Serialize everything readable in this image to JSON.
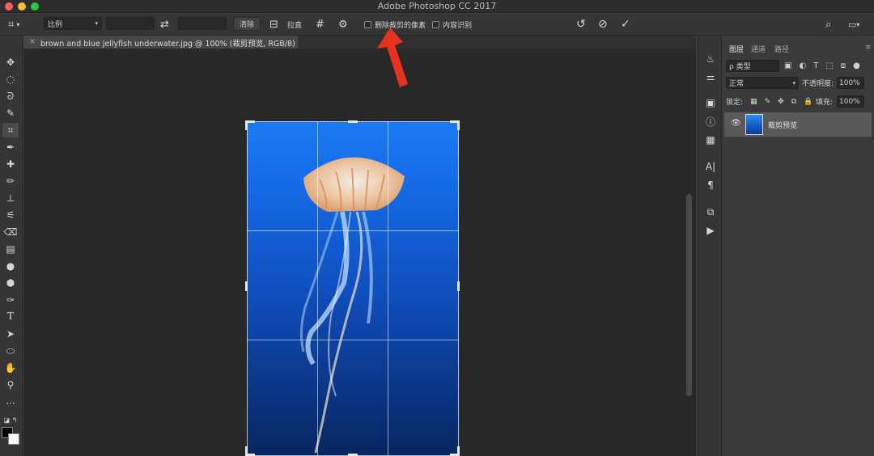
{
  "window": {
    "title": "Adobe Photoshop CC 2017"
  },
  "options": {
    "ratio_label": "比例",
    "clear_label": "清除",
    "straighten_label": "拉直",
    "delete_cropped_label": "删除裁剪的像素",
    "content_aware_label": "内容识别"
  },
  "document": {
    "tab_title": "brown and blue jellyfish underwater.jpg @ 100% (裁剪预览, RGB/8)"
  },
  "panel": {
    "tabs": [
      "图层",
      "通道",
      "路径"
    ],
    "kind_label": "ρ 类型",
    "blend_mode": "正常",
    "opacity_label": "不透明度:",
    "opacity_value": "100%",
    "lock_label": "锁定:",
    "fill_label": "填充:",
    "fill_value": "100%",
    "layer_name": "裁剪预览"
  },
  "colors": {
    "annotation_arrow": "#e8321e",
    "sky_top": "#1a7af5",
    "sky_bottom": "#062660"
  }
}
